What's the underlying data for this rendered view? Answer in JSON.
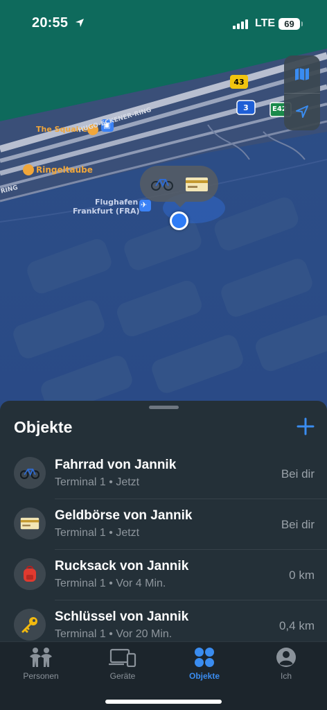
{
  "status_bar": {
    "time": "20:55",
    "network": "LTE",
    "battery": "69"
  },
  "map": {
    "labels": {
      "the_squaire": "The Squaire",
      "hugo_eckener": "HUGO-ECKENER-RING",
      "ringeltaube": "Ringeltaube",
      "ring": "RING",
      "flughafen_line1": "Flughafen",
      "flughafen_line2": "Frankfurt (FRA)"
    },
    "road_shields": {
      "a43": "43",
      "a3": "3",
      "e42": "E42"
    }
  },
  "sheet": {
    "title": "Objekte",
    "items": [
      {
        "name": "Fahrrad von Jannik",
        "location": "Terminal 1",
        "time": "Jetzt",
        "distance": "Bei dir",
        "icon": "bicycle-icon"
      },
      {
        "name": "Geldbörse von Jannik",
        "location": "Terminal 1",
        "time": "Jetzt",
        "distance": "Bei dir",
        "icon": "wallet-icon"
      },
      {
        "name": "Rucksack von Jannik",
        "location": "Terminal 1",
        "time": "Vor 4 Min.",
        "distance": "0 km",
        "icon": "backpack-icon"
      },
      {
        "name": "Schlüssel von Jannik",
        "location": "Terminal 1",
        "time": "Vor 20 Min.",
        "distance": "0,4 km",
        "icon": "key-icon"
      }
    ]
  },
  "tabs": [
    {
      "label": "Personen",
      "icon": "people-icon",
      "active": false
    },
    {
      "label": "Geräte",
      "icon": "devices-icon",
      "active": false
    },
    {
      "label": "Objekte",
      "icon": "items-grid-icon",
      "active": true
    },
    {
      "label": "Ich",
      "icon": "person-circle-icon",
      "active": false
    }
  ],
  "colors": {
    "accent": "#2f7cf6",
    "map_water": "#0f6a5e",
    "map_area": "#2e4f8a"
  }
}
